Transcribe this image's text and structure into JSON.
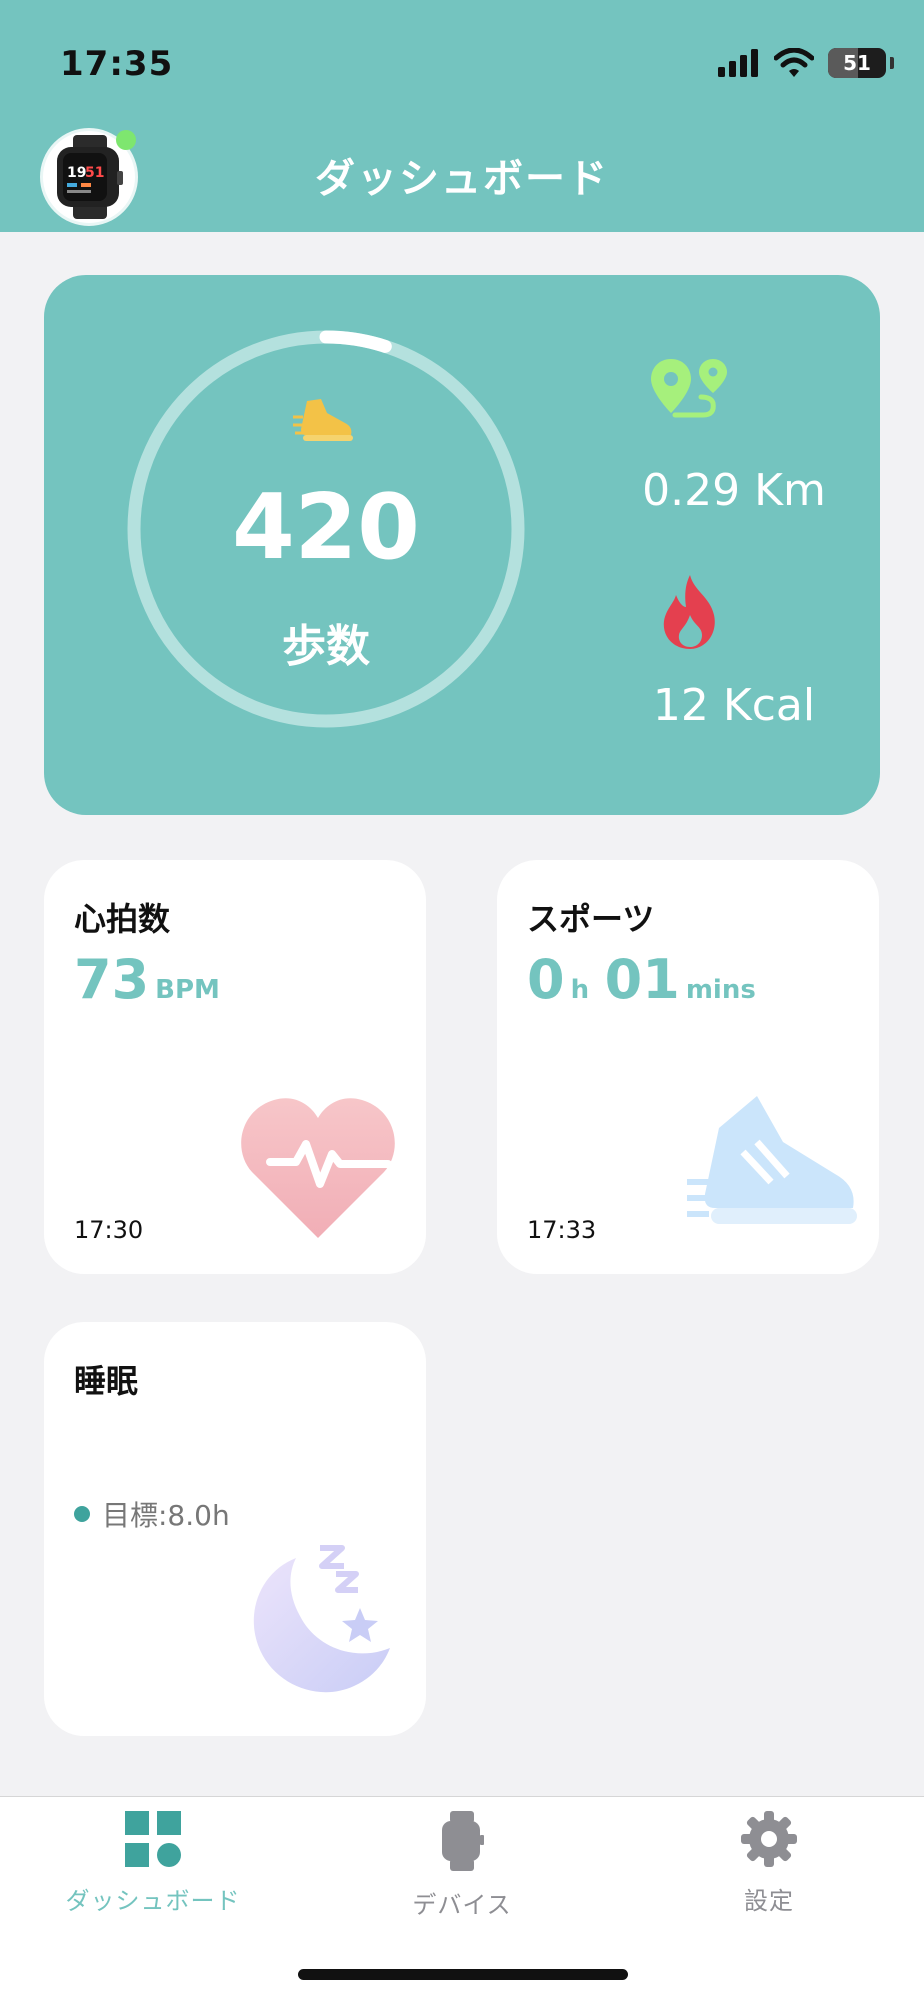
{
  "status_bar": {
    "time": "17:35",
    "battery": "51",
    "battery_level_pct": 51
  },
  "header": {
    "title": "ダッシュボード",
    "device_online": true
  },
  "summary": {
    "steps_value": "420",
    "steps_label": "歩数",
    "steps_progress_fraction": 0.05,
    "distance": "0.29 Km",
    "calories": "12 Kcal"
  },
  "heart_rate": {
    "title": "心拍数",
    "value": "73",
    "unit": "BPM",
    "time": "17:30"
  },
  "sport": {
    "title": "スポーツ",
    "hours": "0",
    "hours_unit": "h",
    "minutes": "01",
    "minutes_unit": "mins",
    "time": "17:33"
  },
  "sleep": {
    "title": "睡眠",
    "goal": "目標:8.0h"
  },
  "tabbar": {
    "items": [
      {
        "label": "ダッシュボード",
        "icon": "dashboard-grid-icon",
        "active": true
      },
      {
        "label": "デバイス",
        "icon": "watch-icon",
        "active": false
      },
      {
        "label": "設定",
        "icon": "gear-icon",
        "active": false
      }
    ]
  },
  "colors": {
    "brand": "#74c4bf",
    "accent_dark": "#3fa39d",
    "steps_icon": "#f3c247",
    "distance_icon": "#a6f07c",
    "calorie_icon": "#e4404f",
    "heart_icon": "#f3b7bd",
    "sport_icon": "#cbe5fb",
    "sleep_icon": "#d7d7f8",
    "inactive_tab": "#8e8e93"
  }
}
